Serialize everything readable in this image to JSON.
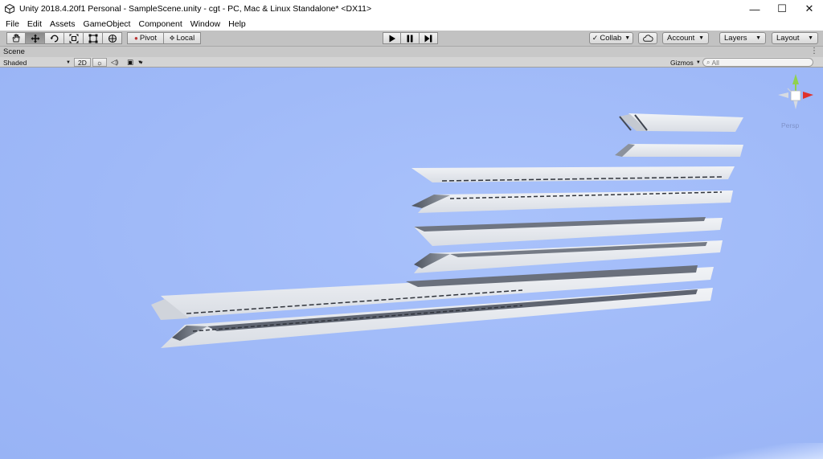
{
  "window": {
    "title": "Unity 2018.4.20f1 Personal - SampleScene.unity - cgt - PC, Mac & Linux Standalone* <DX11>",
    "minimize_glyph": "—",
    "maximize_glyph": "☐",
    "close_glyph": "✕"
  },
  "menu": [
    "File",
    "Edit",
    "Assets",
    "GameObject",
    "Component",
    "Window",
    "Help"
  ],
  "toolbar": {
    "pivot": "Pivot",
    "local": "Local",
    "collab": "Collab",
    "account": "Account",
    "layers": "Layers",
    "layout": "Layout"
  },
  "scene": {
    "tab_label": "Scene",
    "shading_mode": "Shaded",
    "mode_2d": "2D",
    "gizmos": "Gizmos",
    "search_placeholder": "All",
    "projection_label": "Persp"
  },
  "colors": {
    "sky_center": "#a9c2fb",
    "sky_edge": "#98b3f5",
    "plank_top": "#e4e7ec",
    "plank_shadow": "#5e6470",
    "gizmo_y": "#8fd14f",
    "gizmo_x": "#e0322c"
  },
  "icons": {
    "app": "unity-logo-icon",
    "tools": [
      "hand-icon",
      "move-icon",
      "rotate-icon",
      "scale-icon",
      "rect-icon",
      "transform-icon"
    ],
    "playback": [
      "play-icon",
      "pause-icon",
      "step-icon"
    ]
  }
}
